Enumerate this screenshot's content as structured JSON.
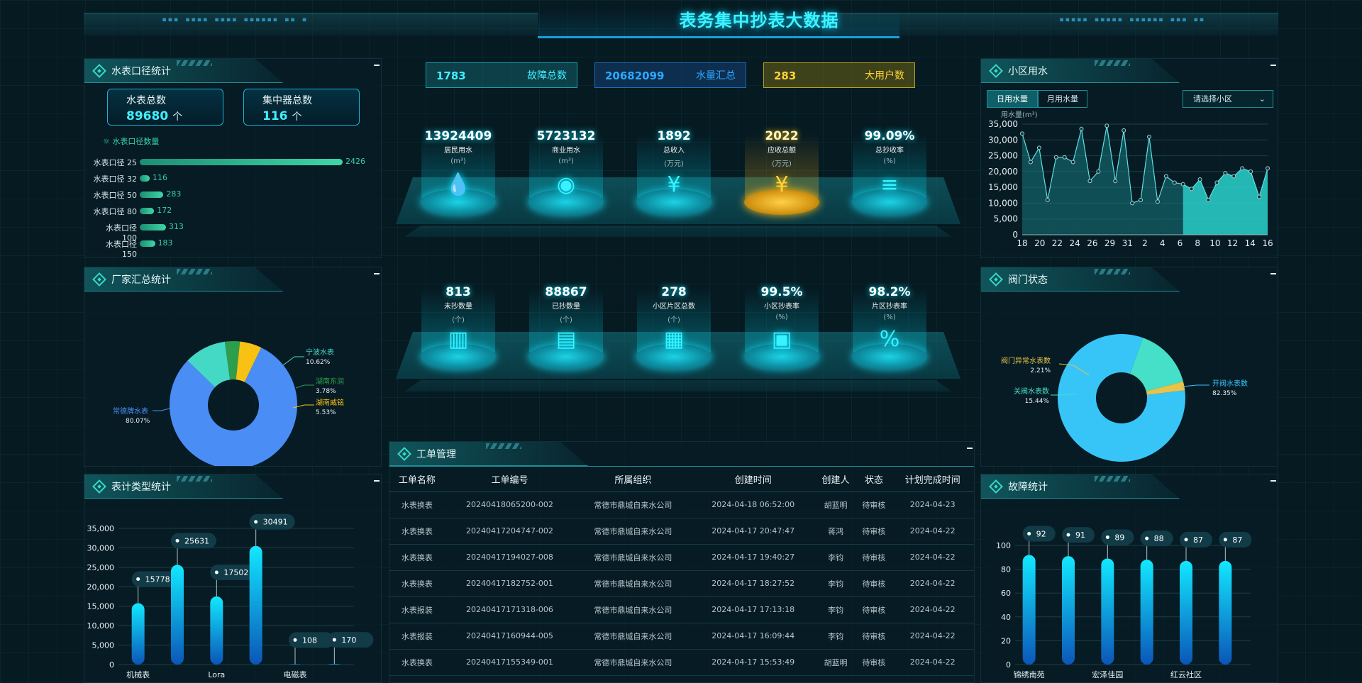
{
  "header": {
    "title": "表务集中抄表大数据",
    "dots_left": "▪▪▪ ▪▪▪▪ ▪▪▪▪ ▪▪▪▪▪▪ ▪▪ ▪",
    "dots_right": "▪▪▪▪▪ ▪▪▪▪▪ ▪▪▪▪▪▪ ▪▪▪ ▪▪"
  },
  "meter_panel": {
    "title": "水表口径统计",
    "cards": [
      {
        "label": "水表总数",
        "value": "89680",
        "unit": "个"
      },
      {
        "label": "集中器总数",
        "value": "116",
        "unit": "个"
      }
    ],
    "section_label": "水表口径数量",
    "bars": [
      {
        "label": "水表口径 25",
        "value": 2426
      },
      {
        "label": "水表口径 32",
        "value": 116
      },
      {
        "label": "水表口径 50",
        "value": 283
      },
      {
        "label": "水表口径 80",
        "value": 172
      },
      {
        "label": "水表口径 100",
        "value": 313
      },
      {
        "label": "水表口径 150",
        "value": 183
      }
    ]
  },
  "manufacturer_panel": {
    "title": "厂家汇总统计"
  },
  "meter_type_panel": {
    "title": "表计类型统计"
  },
  "stats": [
    {
      "value": "1783",
      "label": "故障总数",
      "color": "#3ff0ff"
    },
    {
      "value": "20682099",
      "label": "水量汇总",
      "color": "#2aa8ff"
    },
    {
      "value": "283",
      "label": "大用户数",
      "color": "#ffd236"
    }
  ],
  "kpis_top": [
    {
      "value": "13924409",
      "label": "居民用水",
      "unit": "(m³)",
      "icon": "water-drop-icon",
      "glyph": "💧"
    },
    {
      "value": "5723132",
      "label": "商业用水",
      "unit": "(m³)",
      "icon": "commercial-water-icon",
      "glyph": "◉"
    },
    {
      "value": "1892",
      "label": "总收入",
      "unit": "(万元)",
      "icon": "income-icon",
      "glyph": "¥"
    },
    {
      "value": "2022",
      "label": "应收总额",
      "unit": "(万元)",
      "icon": "receivable-icon",
      "glyph": "¥"
    },
    {
      "value": "99.09%",
      "label": "总抄收率",
      "unit": "(%)",
      "icon": "coins-icon",
      "glyph": "≡"
    }
  ],
  "kpis_bottom": [
    {
      "value": "813",
      "label": "未抄数量",
      "unit": "(个)",
      "icon": "unread-chart-icon",
      "glyph": "▥"
    },
    {
      "value": "88867",
      "label": "已抄数量",
      "unit": "(个)",
      "icon": "read-document-icon",
      "glyph": "▤"
    },
    {
      "value": "278",
      "label": "小区片区总数",
      "unit": "(个)",
      "icon": "buildings-icon",
      "glyph": "▦"
    },
    {
      "value": "99.5%",
      "label": "小区抄表率",
      "unit": "(%)",
      "icon": "community-icon",
      "glyph": "▣"
    },
    {
      "value": "98.2%",
      "label": "片区抄表率",
      "unit": "(%)",
      "icon": "percent-icon",
      "glyph": "%"
    }
  ],
  "workorder": {
    "title": "工单管理",
    "columns": [
      "工单名称",
      "工单编号",
      "所属组织",
      "创建时间",
      "创建人",
      "状态",
      "计划完成时间"
    ],
    "rows": [
      [
        "水表换表",
        "20240418065200-002",
        "常德市鼎城自来水公司",
        "2024-04-18 06:52:00",
        "胡蓝明",
        "待审核",
        "2024-04-23"
      ],
      [
        "水表换表",
        "20240417204747-002",
        "常德市鼎城自来水公司",
        "2024-04-17 20:47:47",
        "蒋鸿",
        "待审核",
        "2024-04-22"
      ],
      [
        "水表换表",
        "20240417194027-008",
        "常德市鼎城自来水公司",
        "2024-04-17 19:40:27",
        "李钧",
        "待审核",
        "2024-04-22"
      ],
      [
        "水表换表",
        "20240417182752-001",
        "常德市鼎城自来水公司",
        "2024-04-17 18:27:52",
        "李钧",
        "待审核",
        "2024-04-22"
      ],
      [
        "水表报装",
        "20240417171318-006",
        "常德市鼎城自来水公司",
        "2024-04-17 17:13:18",
        "李钧",
        "待审核",
        "2024-04-22"
      ],
      [
        "水表报装",
        "20240417160944-005",
        "常德市鼎城自来水公司",
        "2024-04-17 16:09:44",
        "李钧",
        "待审核",
        "2024-04-22"
      ],
      [
        "水表换表",
        "20240417155349-001",
        "常德市鼎城自来水公司",
        "2024-04-17 15:53:49",
        "胡蓝明",
        "待审核",
        "2024-04-22"
      ]
    ]
  },
  "community_panel": {
    "title": "小区用水",
    "tabs": [
      "日用水量",
      "月用水量"
    ],
    "select": "请选择小区",
    "ylabel": "用水量(m³)"
  },
  "valve_panel": {
    "title": "阀门状态"
  },
  "fault_panel": {
    "title": "故障统计"
  },
  "chart_data": [
    {
      "type": "pie",
      "title": "厂家汇总统计",
      "labels": [
        "常德牌水表",
        "宁波水表",
        "湖南东润",
        "湖南威铭"
      ],
      "values": [
        80.07,
        10.62,
        3.78,
        5.53
      ],
      "display": [
        "80.07%",
        "10.62%",
        "3.78%",
        "5.53%"
      ],
      "colors": [
        "#4a8df5",
        "#44d9c4",
        "#2e9e4c",
        "#f8c215"
      ]
    },
    {
      "type": "bar",
      "title": "表计类型统计",
      "categories": [
        "机械表",
        "",
        "Lora",
        "",
        "电磁表",
        ""
      ],
      "values": [
        15778,
        25631,
        17502,
        30491,
        108,
        170
      ],
      "yticks": [
        "0",
        "5,000",
        "10,000",
        "15,000",
        "20,000",
        "25,000",
        "30,000",
        "35,000"
      ],
      "ylim": [
        0,
        35000
      ]
    },
    {
      "type": "area",
      "title": "小区用水",
      "ylabel": "用水量(m³)",
      "ylim": [
        0,
        35000
      ],
      "yticks": [
        "0",
        "5,000",
        "10,000",
        "15,000",
        "20,000",
        "25,000",
        "30,000",
        "35,000"
      ],
      "xticks": [
        "18",
        "20",
        "22",
        "24",
        "26",
        "29",
        "31",
        "2",
        "4",
        "6",
        "8",
        "10",
        "12",
        "14",
        "16"
      ],
      "values": [
        32000,
        23000,
        27500,
        11000,
        24500,
        24500,
        23000,
        33500,
        17000,
        20000,
        34500,
        17000,
        33000,
        10000,
        11000,
        31000,
        10500,
        18500,
        16500,
        16000,
        14500,
        17500,
        11000,
        16500,
        19500,
        18500,
        21000,
        20000,
        12000,
        21000
      ],
      "highlight_start": 19
    },
    {
      "type": "pie",
      "title": "阀门状态",
      "labels": [
        "开阀水表数",
        "关阀水表数",
        "阀门异常水表数"
      ],
      "values": [
        82.35,
        15.44,
        2.21
      ],
      "display": [
        "82.35%",
        "15.44%",
        "2.21%"
      ],
      "colors": [
        "#37c5f8",
        "#46e0c8",
        "#e7c34a"
      ]
    },
    {
      "type": "bar",
      "title": "故障统计",
      "categories": [
        "锦绣南苑",
        "",
        "宏泽佳园",
        "",
        "红云社区",
        ""
      ],
      "values": [
        92,
        91,
        89,
        88,
        87,
        87
      ],
      "yticks": [
        "0",
        "20",
        "40",
        "60",
        "80",
        "100"
      ],
      "ylim": [
        0,
        100
      ]
    }
  ]
}
